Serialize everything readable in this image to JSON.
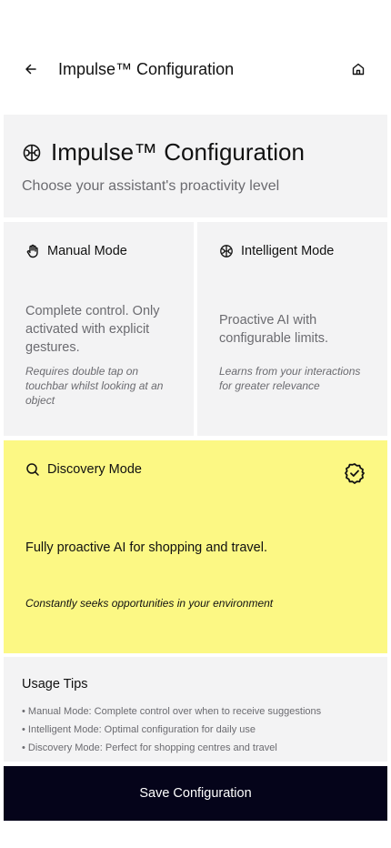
{
  "topbar": {
    "title": "Impulse™ Configuration",
    "back_icon": "arrow-left-icon",
    "home_icon": "home-icon"
  },
  "header": {
    "icon": "brain-icon",
    "title": "Impulse™ Configuration",
    "subtitle": "Choose your assistant's proactivity level"
  },
  "modes": {
    "manual": {
      "icon": "hand-icon",
      "title": "Manual Mode",
      "description": "Complete control. Only activated with explicit gestures.",
      "note": "Requires double tap on touchbar whilst looking at an object",
      "selected": false
    },
    "intelligent": {
      "icon": "brain-icon",
      "title": "Intelligent Mode",
      "description": "Proactive AI with configurable limits.",
      "note": "Learns from your interactions for greater relevance",
      "selected": false
    },
    "discovery": {
      "icon": "search-icon",
      "title": "Discovery Mode",
      "description": "Fully proactive AI for shopping and travel.",
      "note": "Constantly seeks opportunities in your environment",
      "selected": true,
      "selected_icon": "check-badge-icon"
    }
  },
  "tips": {
    "title": "Usage Tips",
    "items": [
      "• Manual Mode: Complete control over when to receive suggestions",
      "• Intelligent Mode: Optimal configuration for daily use",
      "• Discovery Mode: Perfect for shopping centres and travel"
    ]
  },
  "save_button": {
    "label": "Save Configuration"
  },
  "colors": {
    "card_bg": "#f3f3f4",
    "selected_bg": "#fcf884",
    "button_bg": "#05041a",
    "muted_text": "#6b6b70"
  }
}
